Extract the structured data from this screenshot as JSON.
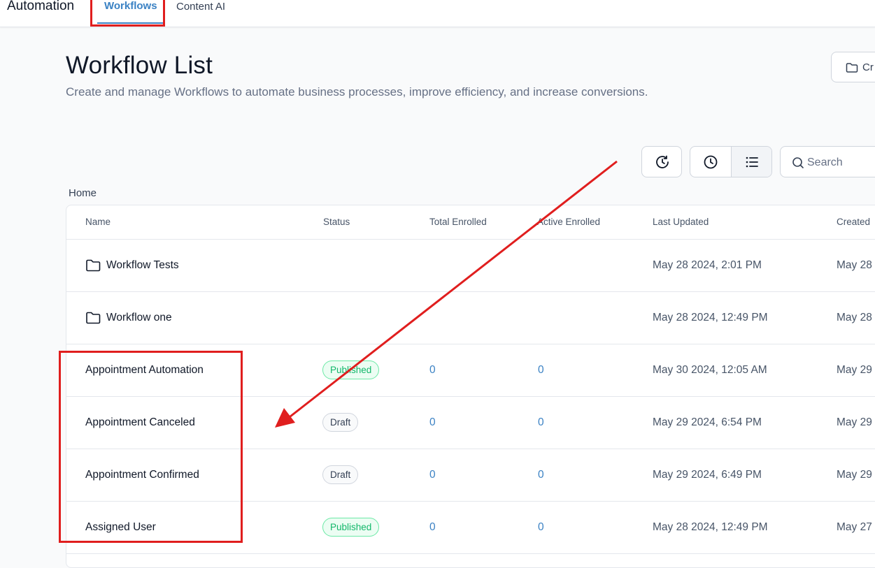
{
  "topbar": {
    "app_title": "Automation",
    "tabs": [
      {
        "label": "Workflows",
        "active": true
      },
      {
        "label": "Content AI",
        "active": false
      }
    ]
  },
  "page": {
    "title": "Workflow List",
    "description": "Create and manage Workflows to automate business processes, improve efficiency, and increase conversions."
  },
  "toolbar": {
    "create_label": "Cr",
    "search_placeholder": "Search",
    "icons": [
      "history-icon",
      "clock-icon",
      "list-view-icon"
    ]
  },
  "breadcrumb": "Home",
  "table": {
    "columns": [
      "Name",
      "Status",
      "Total Enrolled",
      "Active Enrolled",
      "Last Updated",
      "Created"
    ],
    "rows": [
      {
        "type": "folder",
        "name": "Workflow Tests",
        "status": "",
        "total": "",
        "active": "",
        "updated": "May 28 2024, 2:01 PM",
        "created": "May 28"
      },
      {
        "type": "folder",
        "name": "Workflow one",
        "status": "",
        "total": "",
        "active": "",
        "updated": "May 28 2024, 12:49 PM",
        "created": "May 28"
      },
      {
        "type": "workflow",
        "name": "Appointment Automation",
        "status": "Published",
        "total": "0",
        "active": "0",
        "updated": "May 30 2024, 12:05 AM",
        "created": "May 29"
      },
      {
        "type": "workflow",
        "name": "Appointment Canceled",
        "status": "Draft",
        "total": "0",
        "active": "0",
        "updated": "May 29 2024, 6:54 PM",
        "created": "May 29"
      },
      {
        "type": "workflow",
        "name": "Appointment Confirmed",
        "status": "Draft",
        "total": "0",
        "active": "0",
        "updated": "May 29 2024, 6:49 PM",
        "created": "May 29"
      },
      {
        "type": "workflow",
        "name": "Assigned User",
        "status": "Published",
        "total": "0",
        "active": "0",
        "updated": "May 28 2024, 12:49 PM",
        "created": "May 27"
      }
    ]
  },
  "colors": {
    "accent": "#3b82c4",
    "annotation": "#e01e1e",
    "published": "#12b76a"
  }
}
